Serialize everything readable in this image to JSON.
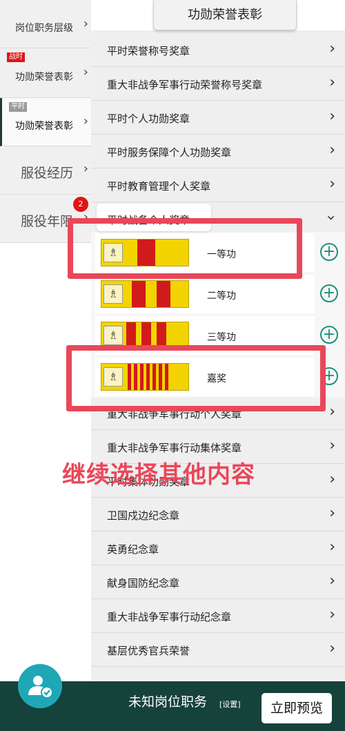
{
  "header": {
    "title": "功勋荣誉表彰"
  },
  "sidebar": {
    "items": [
      {
        "label": "岗位职务层级",
        "tag": ""
      },
      {
        "label": "功勋荣誉表彰",
        "tag": "战时"
      },
      {
        "label": "功勋荣誉表彰",
        "tag": "平时"
      },
      {
        "label": "服役经历",
        "tag": ""
      },
      {
        "label": "服役年限",
        "tag": "",
        "badge": "2"
      }
    ]
  },
  "list": {
    "top_rows": [
      "平时荣誉称号奖章",
      "重大非战争军事行动荣誉称号奖章",
      "平时个人功勋奖章",
      "平时服务保障个人功勋奖章",
      "平时教育管理个人奖章"
    ],
    "expanded_title": "平时战备个人奖章",
    "medals": [
      {
        "name": "一等功",
        "stripes": 1
      },
      {
        "name": "二等功",
        "stripes": 2
      },
      {
        "name": "三等功",
        "stripes": 3
      },
      {
        "name": "嘉奖",
        "stripes": 7
      }
    ],
    "bottom_rows": [
      "重大非战争军事行动个人奖章",
      "重大非战争军事行动集体奖章",
      "平时集体功勋奖章",
      "卫国戍边纪念章",
      "英勇纪念章",
      "献身国防纪念章",
      "重大非战争军事行动纪念章",
      "基层优秀官兵荣誉"
    ]
  },
  "annotation": {
    "text": "继续选择其他内容",
    "color": "#e9475a"
  },
  "bottom_bar": {
    "position_label": "未知岗位职务",
    "settings_label": "[设置]",
    "preview_button": "立即预览"
  },
  "colors": {
    "accent": "#1a8f7c",
    "bar": "#15423a",
    "ribbon": "#f3d400",
    "stripe": "#d11a1a"
  }
}
